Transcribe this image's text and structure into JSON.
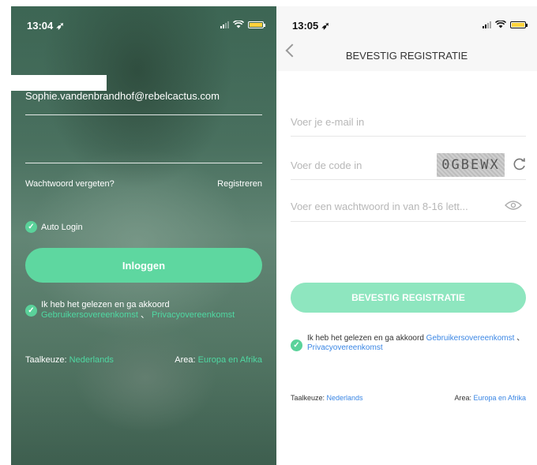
{
  "login_screen": {
    "status": {
      "time": "13:04"
    },
    "email_value": "Sophie.vandenbrandhof@rebelcactus.com",
    "password_value": "",
    "forgot_password": "Wachtwoord vergeten?",
    "register": "Registreren",
    "auto_login": "Auto Login",
    "login_button": "Inloggen",
    "agree_text": "Ik heb het gelezen en ga akkoord ",
    "agree_link_user": "Gebruikersovereenkomst",
    "agree_separator": "、",
    "agree_link_privacy": "Privacyovereenkomst",
    "language_label": "Taalkeuze: ",
    "language_value": "Nederlands",
    "area_label": "Area: ",
    "area_value": "Europa en Afrika"
  },
  "register_screen": {
    "status": {
      "time": "13:05"
    },
    "title": "BEVESTIG REGISTRATIE",
    "email_placeholder": "Voer je e-mail in",
    "code_placeholder": "Voer de code in",
    "captcha_code": "0GBEWX",
    "password_placeholder": "Voer een wachtwoord in van 8-16 lett...",
    "confirm_button": "BEVESTIG REGISTRATIE",
    "agree_text": "Ik heb het gelezen en ga akkoord ",
    "agree_link_user": "Gebruikersovereenkomst",
    "agree_separator": "、",
    "agree_link_privacy": "Privacyovereenkomst",
    "language_label": "Taalkeuze: ",
    "language_value": "Nederlands",
    "area_label": "Area: ",
    "area_value": "Europa en Afrika"
  },
  "colors": {
    "accent_green": "#5ed7a0",
    "button_disabled": "#8ee6bf",
    "link_blue": "#3a86e4",
    "battery_yellow": "#ffd23c"
  },
  "icons": [
    "location-arrow-icon",
    "signal-icon",
    "wifi-icon",
    "battery-icon",
    "back-chevron-icon",
    "refresh-icon",
    "eye-icon",
    "check-circle-icon"
  ]
}
